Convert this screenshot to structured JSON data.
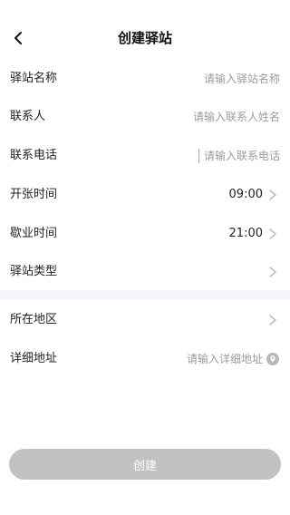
{
  "header": {
    "title": "创建驿站",
    "back_icon": "chevron-left-icon"
  },
  "form": {
    "station_name": {
      "label": "驿站名称",
      "placeholder": "请输入驿站名称",
      "value": ""
    },
    "contact": {
      "label": "联系人",
      "placeholder": "请输入联系人姓名",
      "value": ""
    },
    "phone": {
      "label": "联系电话",
      "placeholder": "请输入联系电话",
      "value": ""
    },
    "open_time": {
      "label": "开张时间",
      "value": "09:00"
    },
    "close_time": {
      "label": "歇业时间",
      "value": "21:00"
    },
    "station_type": {
      "label": "驿站类型",
      "value": ""
    },
    "region": {
      "label": "所在地区",
      "value": ""
    },
    "address": {
      "label": "详细地址",
      "placeholder": "请输入详细地址",
      "value": "",
      "icon": "location-pin-icon"
    }
  },
  "submit": {
    "label": "创建",
    "color": "#c2c2c4"
  },
  "colors": {
    "caret": "#e0a82e",
    "placeholder": "#9b9b9b",
    "section_divider": "#f4f5fa"
  }
}
